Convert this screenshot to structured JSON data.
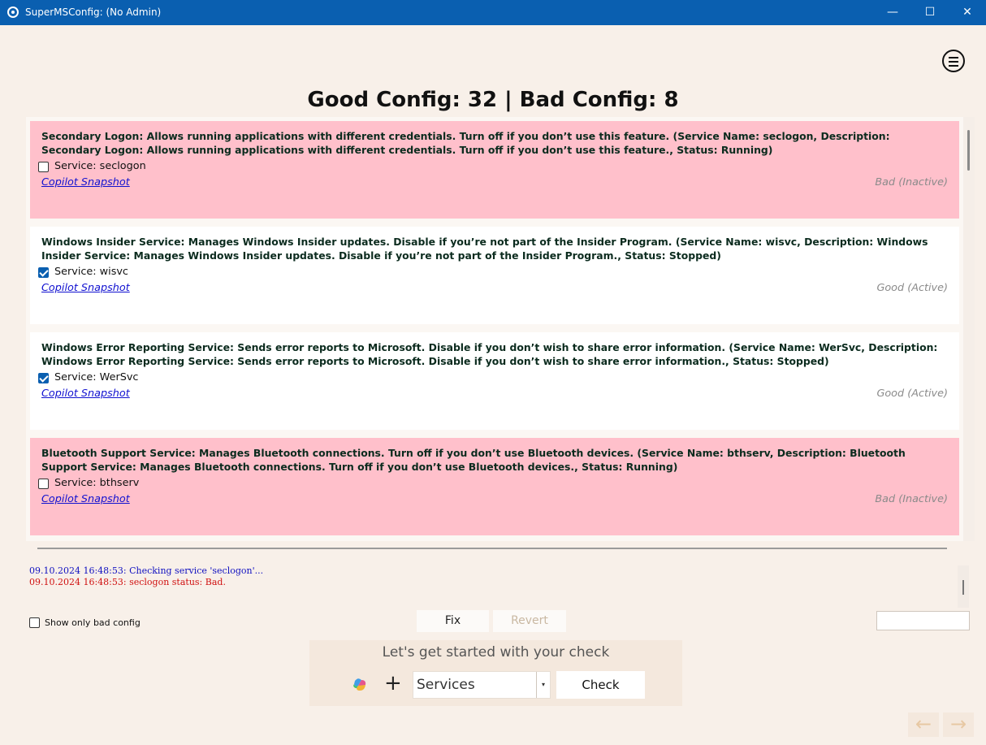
{
  "window": {
    "title": "SuperMSConfig: (No Admin)",
    "controls": {
      "minimize": "—",
      "maximize": "☐",
      "close": "✕"
    }
  },
  "header": {
    "summary": "Good Config: 32 | Bad Config: 8"
  },
  "cards": [
    {
      "state": "bad",
      "description": "Secondary Logon: Allows running applications with different credentials. Turn off if you don’t use this feature. (Service Name: seclogon, Description: Secondary Logon: Allows running applications with different credentials. Turn off if you don’t use this feature., Status: Running)",
      "checked": false,
      "service_label": "Service: seclogon",
      "link": "Copilot Snapshot",
      "status": "Bad (Inactive)"
    },
    {
      "state": "good",
      "description": "Windows Insider Service: Manages Windows Insider updates. Disable if you’re not part of the Insider Program. (Service Name: wisvc, Description: Windows Insider Service: Manages Windows Insider updates. Disable if you’re not part of the Insider Program., Status: Stopped)",
      "checked": true,
      "service_label": "Service: wisvc",
      "link": "Copilot Snapshot",
      "status": "Good (Active)"
    },
    {
      "state": "good",
      "description": "Windows Error Reporting Service: Sends error reports to Microsoft. Disable if you don’t wish to share error information. (Service Name: WerSvc, Description: Windows Error Reporting Service: Sends error reports to Microsoft. Disable if you don’t wish to share error information., Status: Stopped)",
      "checked": true,
      "service_label": "Service: WerSvc",
      "link": "Copilot Snapshot",
      "status": "Good (Active)"
    },
    {
      "state": "bad",
      "description": "Bluetooth Support Service: Manages Bluetooth connections. Turn off if you don’t use Bluetooth devices. (Service Name: bthserv, Description: Bluetooth Support Service: Manages Bluetooth connections. Turn off if you don’t use Bluetooth devices., Status: Running)",
      "checked": false,
      "service_label": "Service: bthserv",
      "link": "Copilot Snapshot",
      "status": "Bad (Inactive)"
    }
  ],
  "log": {
    "line1": "09.10.2024 16:48:53: Checking service 'seclogon'...",
    "line2": "09.10.2024 16:48:53: seclogon status: Bad.",
    "line1_color": "#1010c0",
    "line2_color": "#d01010"
  },
  "controls": {
    "show_bad_only_label": "Show only bad config",
    "show_bad_only_checked": false,
    "fix_label": "Fix",
    "revert_label": "Revert",
    "side_input_value": ""
  },
  "start_panel": {
    "title": "Let's get started with your check",
    "plus_symbol": "+",
    "category_selected": "Services",
    "check_label": "Check"
  },
  "nav": {
    "back_symbol": "←",
    "forward_symbol": "→"
  },
  "colors": {
    "titlebar": "#0a5fb0",
    "bad_card": "#ffc0cb",
    "good_card": "#ffffff",
    "background": "#f8f0e9",
    "link": "#1010d0"
  },
  "icons": {
    "app": "gear-icon",
    "menu": "hamburger-menu-icon",
    "copilot": "copilot-icon",
    "add": "plus-icon"
  }
}
